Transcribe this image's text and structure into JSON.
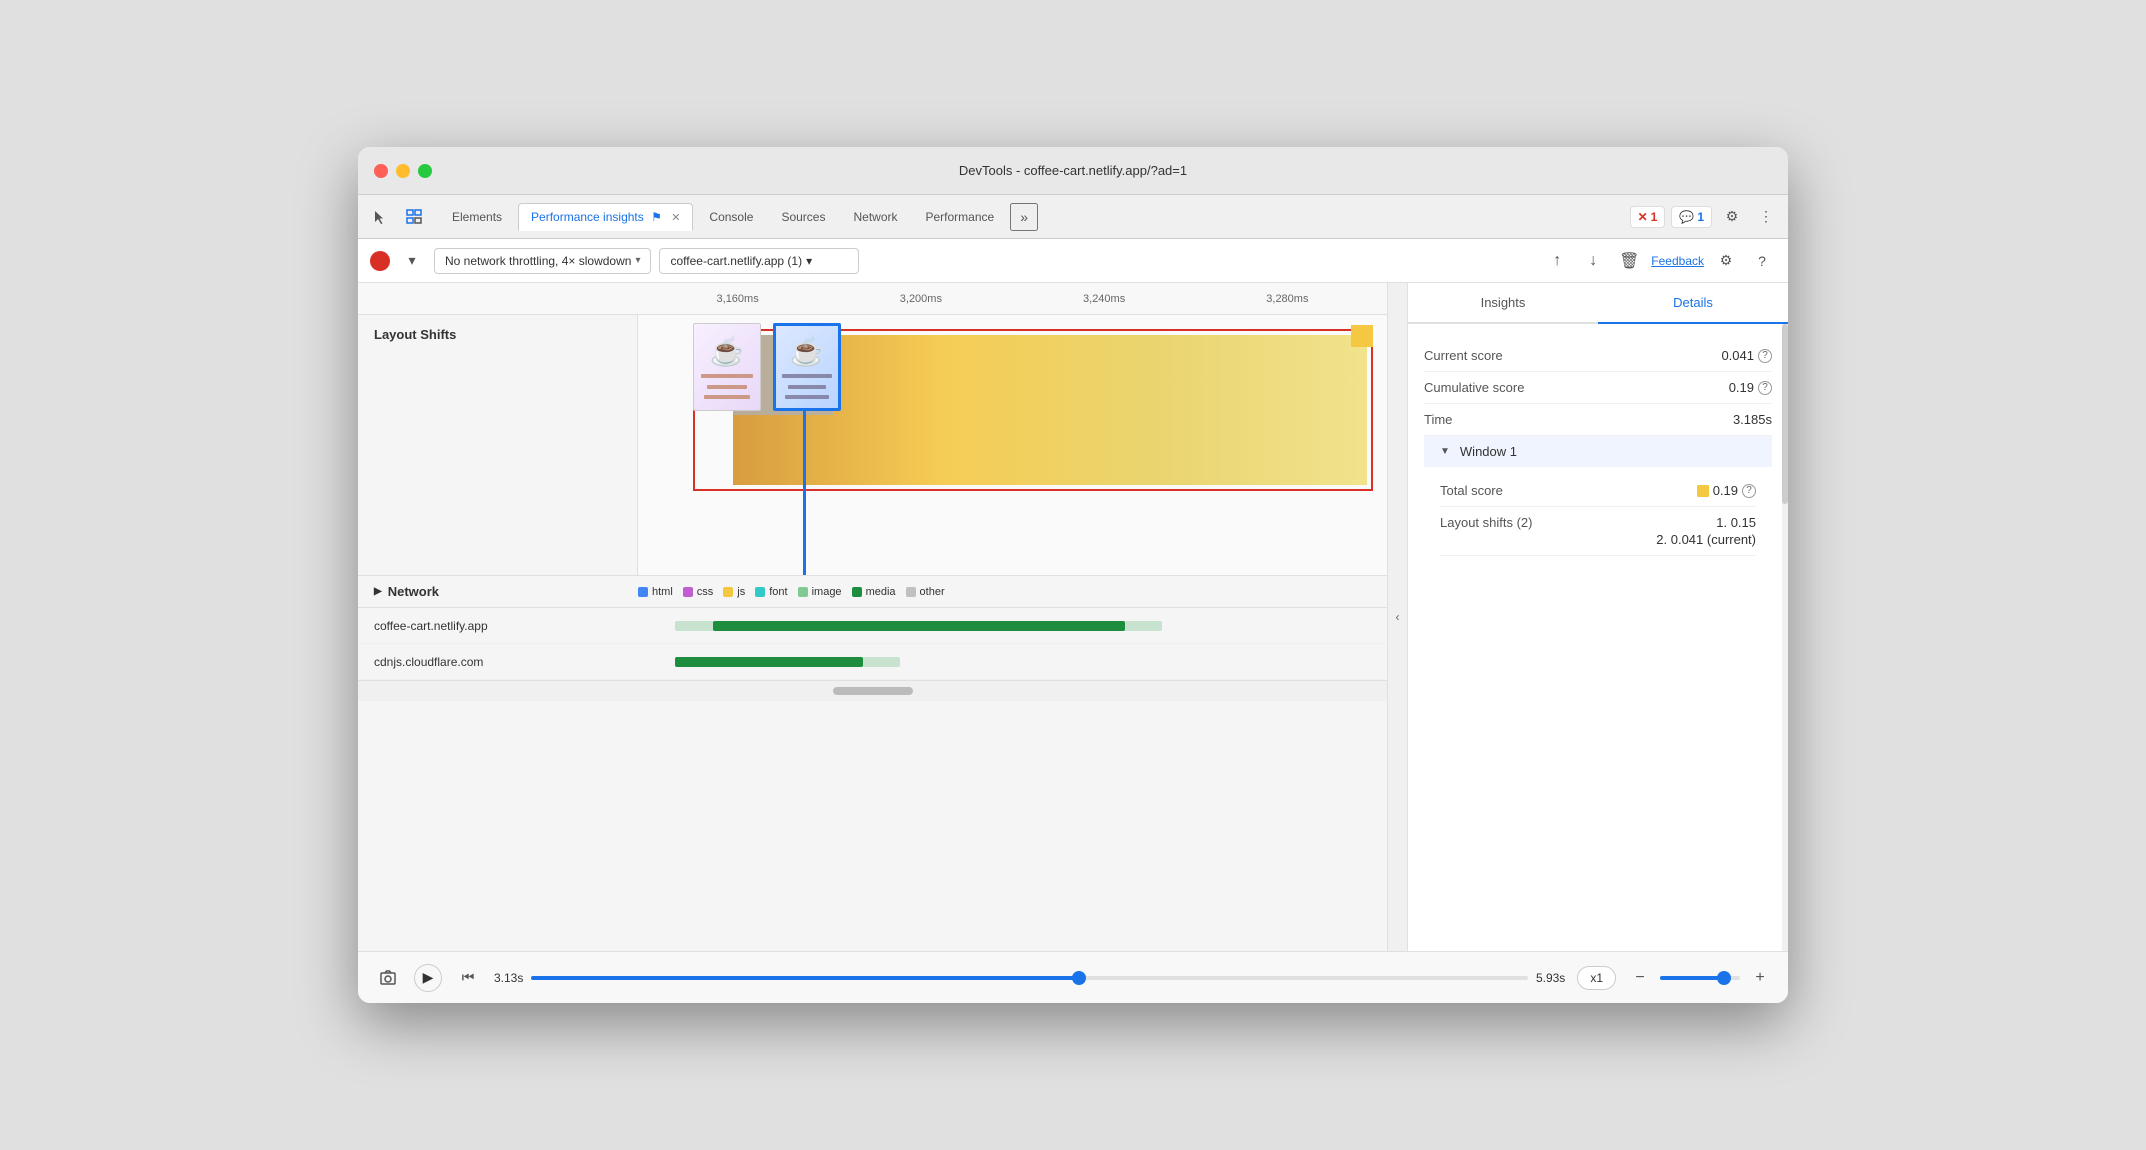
{
  "window": {
    "title": "DevTools - coffee-cart.netlify.app/?ad=1"
  },
  "tabs": {
    "items": [
      {
        "label": "Elements",
        "active": false
      },
      {
        "label": "Performance insights",
        "active": true,
        "has_icon": true
      },
      {
        "label": "Console",
        "active": false
      },
      {
        "label": "Sources",
        "active": false
      },
      {
        "label": "Network",
        "active": false
      },
      {
        "label": "Performance",
        "active": false
      }
    ],
    "overflow": "»",
    "error_count": "1",
    "message_count": "1"
  },
  "toolbar": {
    "throttle_label": "No network throttling, 4× slowdown",
    "url_label": "coffee-cart.netlify.app (1)",
    "feedback_label": "Feedback"
  },
  "timeline": {
    "markers": [
      "3,160ms",
      "3,200ms",
      "3,240ms",
      "3,280ms"
    ]
  },
  "layout_shifts": {
    "label": "Layout Shifts"
  },
  "network": {
    "label": "Network",
    "legend": [
      {
        "type": "html",
        "color": "#4285f4"
      },
      {
        "type": "css",
        "color": "#c060d0"
      },
      {
        "type": "js",
        "color": "#f5c842"
      },
      {
        "type": "font",
        "color": "#33c9c9"
      },
      {
        "type": "image",
        "color": "#81c995"
      },
      {
        "type": "media",
        "color": "#1e8e3e"
      },
      {
        "type": "other",
        "color": "#c0c0c0"
      }
    ],
    "rows": [
      {
        "label": "coffee-cart.netlify.app",
        "bar_offset": "8%",
        "bar_width": "62%"
      },
      {
        "label": "cdnjs.cloudflare.com",
        "bar_offset": "8%",
        "bar_width": "30%"
      }
    ]
  },
  "bottom_toolbar": {
    "time_start": "3.13s",
    "time_end": "5.93s",
    "speed": "x1"
  },
  "right_panel": {
    "tabs": [
      "Insights",
      "Details"
    ],
    "active_tab": "Details",
    "details": {
      "current_score_label": "Current score",
      "current_score_value": "0.041",
      "cumulative_score_label": "Cumulative score",
      "cumulative_score_value": "0.19",
      "time_label": "Time",
      "time_value": "3.185s",
      "window_label": "Window 1",
      "total_score_label": "Total score",
      "total_score_value": "0.19",
      "layout_shifts_label": "Layout shifts (2)",
      "layout_shifts_value_1": "1. 0.15",
      "layout_shifts_value_2": "2. 0.041 (current)"
    }
  }
}
